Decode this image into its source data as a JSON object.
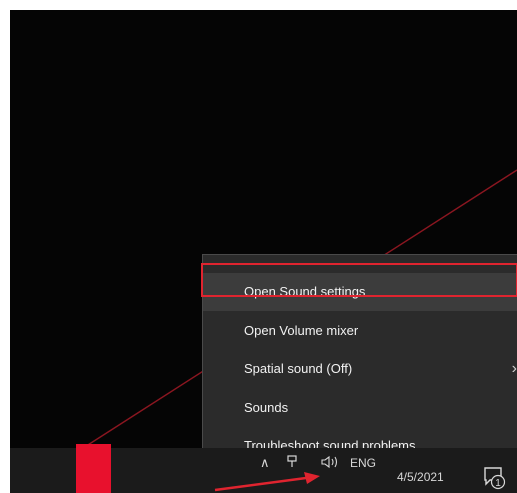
{
  "context_menu": {
    "items": [
      {
        "label": "Open Sound settings",
        "mnemonic_underlined": "e"
      },
      {
        "label": "Open Volume mixer",
        "mnemonic_underlined": "m"
      },
      {
        "label": "Spatial sound (Off)",
        "has_submenu": true
      },
      {
        "label": "Sounds",
        "mnemonic_underlined": "S"
      },
      {
        "label": "Troubleshoot sound problems",
        "mnemonic_underlined": "T"
      }
    ],
    "highlighted_index": 0
  },
  "taskbar": {
    "tray": {
      "chevron_icon": "chevron-up-icon",
      "network_icon": "network-icon",
      "volume_icon": "speaker-icon",
      "language": "ENG",
      "date": "4/5/2021",
      "notification_count": "1"
    }
  },
  "colors": {
    "accent_red": "#e0242f",
    "menu_bg": "#2b2b2b",
    "taskbar_bg": "#1b1b1b"
  }
}
